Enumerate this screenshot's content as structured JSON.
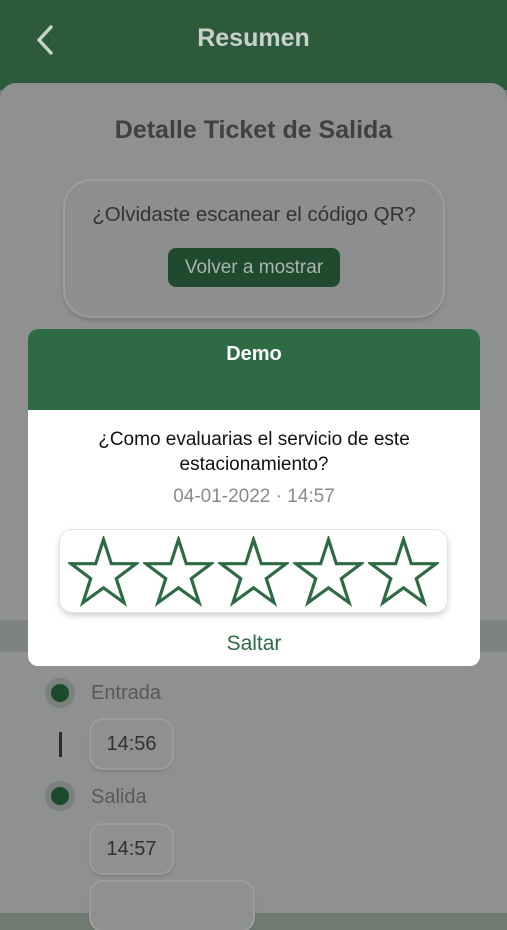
{
  "header": {
    "title": "Resumen",
    "back_icon": "chevron-left-icon"
  },
  "sheet": {
    "title": "Detalle Ticket de Salida",
    "qr_question": "¿Olvidaste escanear el código QR?",
    "qr_button": "Volver a mostrar"
  },
  "timeline": {
    "entry_label": "Entrada",
    "entry_time": "14:56",
    "exit_label": "Salida",
    "exit_time": "14:57"
  },
  "rating_modal": {
    "title": "Demo",
    "question": "¿Como evaluarias el servicio de este estacionamiento?",
    "datetime": "04-01-2022 · 14:57",
    "stars_total": 5,
    "stars_selected": 0,
    "skip_label": "Saltar"
  },
  "colors": {
    "brand_green": "#2e6b44",
    "dark_green": "#1f4a2d",
    "dim_overlay": "#8e918f"
  }
}
